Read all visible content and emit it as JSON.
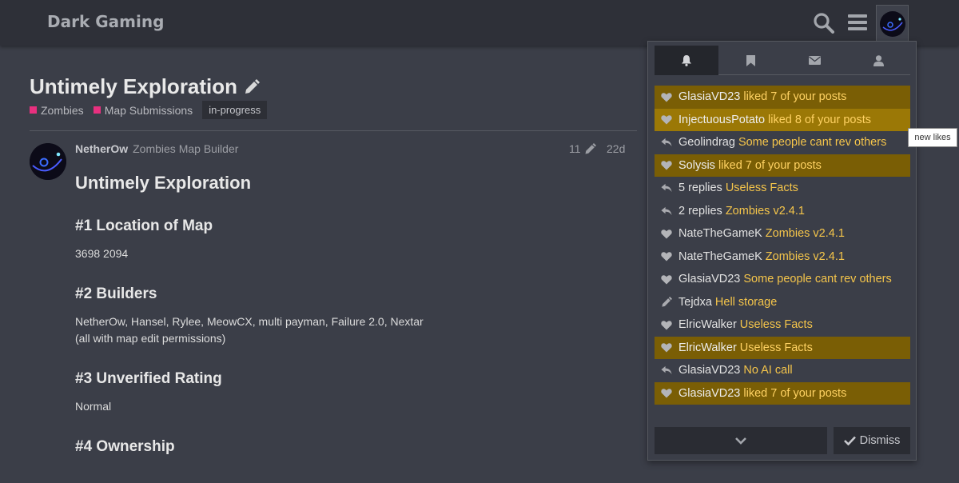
{
  "header": {
    "site_title": "Dark Gaming"
  },
  "topic": {
    "title": "Untimely Exploration",
    "categories": [
      {
        "label": "Zombies",
        "color": "#e8307f"
      },
      {
        "label": "Map Submissions",
        "color": "#e8307f"
      }
    ],
    "tag": "in-progress"
  },
  "post": {
    "username": "NetherOw",
    "user_title": "Zombies Map Builder",
    "edit_count": "11",
    "age": "22d",
    "heading": "Untimely Exploration",
    "sections": [
      {
        "heading": "#1 Location of Map",
        "lines": [
          "3698 2094"
        ]
      },
      {
        "heading": "#2 Builders",
        "lines": [
          "NetherOw, Hansel, Rylee, MeowCX, multi payman, Failure 2.0, Nextar",
          "(all with map edit permissions)"
        ]
      },
      {
        "heading": "#3 Unverified Rating",
        "lines": [
          "Normal"
        ]
      },
      {
        "heading": "#4 Ownership",
        "lines": []
      }
    ]
  },
  "notifications": {
    "tabs": [
      "bell-icon",
      "bookmark-icon",
      "envelope-icon",
      "user-icon"
    ],
    "items": [
      {
        "icon": "heart-icon",
        "who": "GlasiaVD23",
        "what": "liked 7 of your posts",
        "unread": true
      },
      {
        "icon": "heart-icon",
        "who": "InjectuousPotato",
        "what": "liked 8 of your posts",
        "unread": true
      },
      {
        "icon": "reply-icon",
        "who": "Geolindrag",
        "what": "Some people cant rev others",
        "unread": false
      },
      {
        "icon": "heart-icon",
        "who": "Solysis",
        "what": "liked 7 of your posts",
        "unread": true
      },
      {
        "icon": "reply-icon",
        "who": "5 replies",
        "what": "Useless Facts",
        "unread": false
      },
      {
        "icon": "reply-icon",
        "who": "2 replies",
        "what": "Zombies v2.4.1",
        "unread": false
      },
      {
        "icon": "heart-icon",
        "who": "NateTheGameK",
        "what": "Zombies v2.4.1",
        "unread": false
      },
      {
        "icon": "heart-icon",
        "who": "NateTheGameK",
        "what": "Zombies v2.4.1",
        "unread": false
      },
      {
        "icon": "heart-icon",
        "who": "GlasiaVD23",
        "what": "Some people cant rev others",
        "unread": false
      },
      {
        "icon": "pencil-icon",
        "who": "Tejdxa",
        "what": "Hell storage",
        "unread": false
      },
      {
        "icon": "heart-icon",
        "who": "ElricWalker",
        "what": "Useless Facts",
        "unread": false
      },
      {
        "icon": "heart-icon",
        "who": "ElricWalker",
        "what": "Useless Facts",
        "unread": true
      },
      {
        "icon": "reply-icon",
        "who": "GlasiaVD23",
        "what": "No AI call",
        "unread": false
      },
      {
        "icon": "heart-icon",
        "who": "GlasiaVD23",
        "what": "liked 7 of your posts",
        "unread": true
      }
    ],
    "dismiss_label": "Dismiss",
    "tooltip": "new likes"
  },
  "colors": {
    "accent": "#f5c54a",
    "unread_bg": "#7a5e05",
    "header_bg": "#2e3038",
    "page_bg": "#3b3e48"
  }
}
